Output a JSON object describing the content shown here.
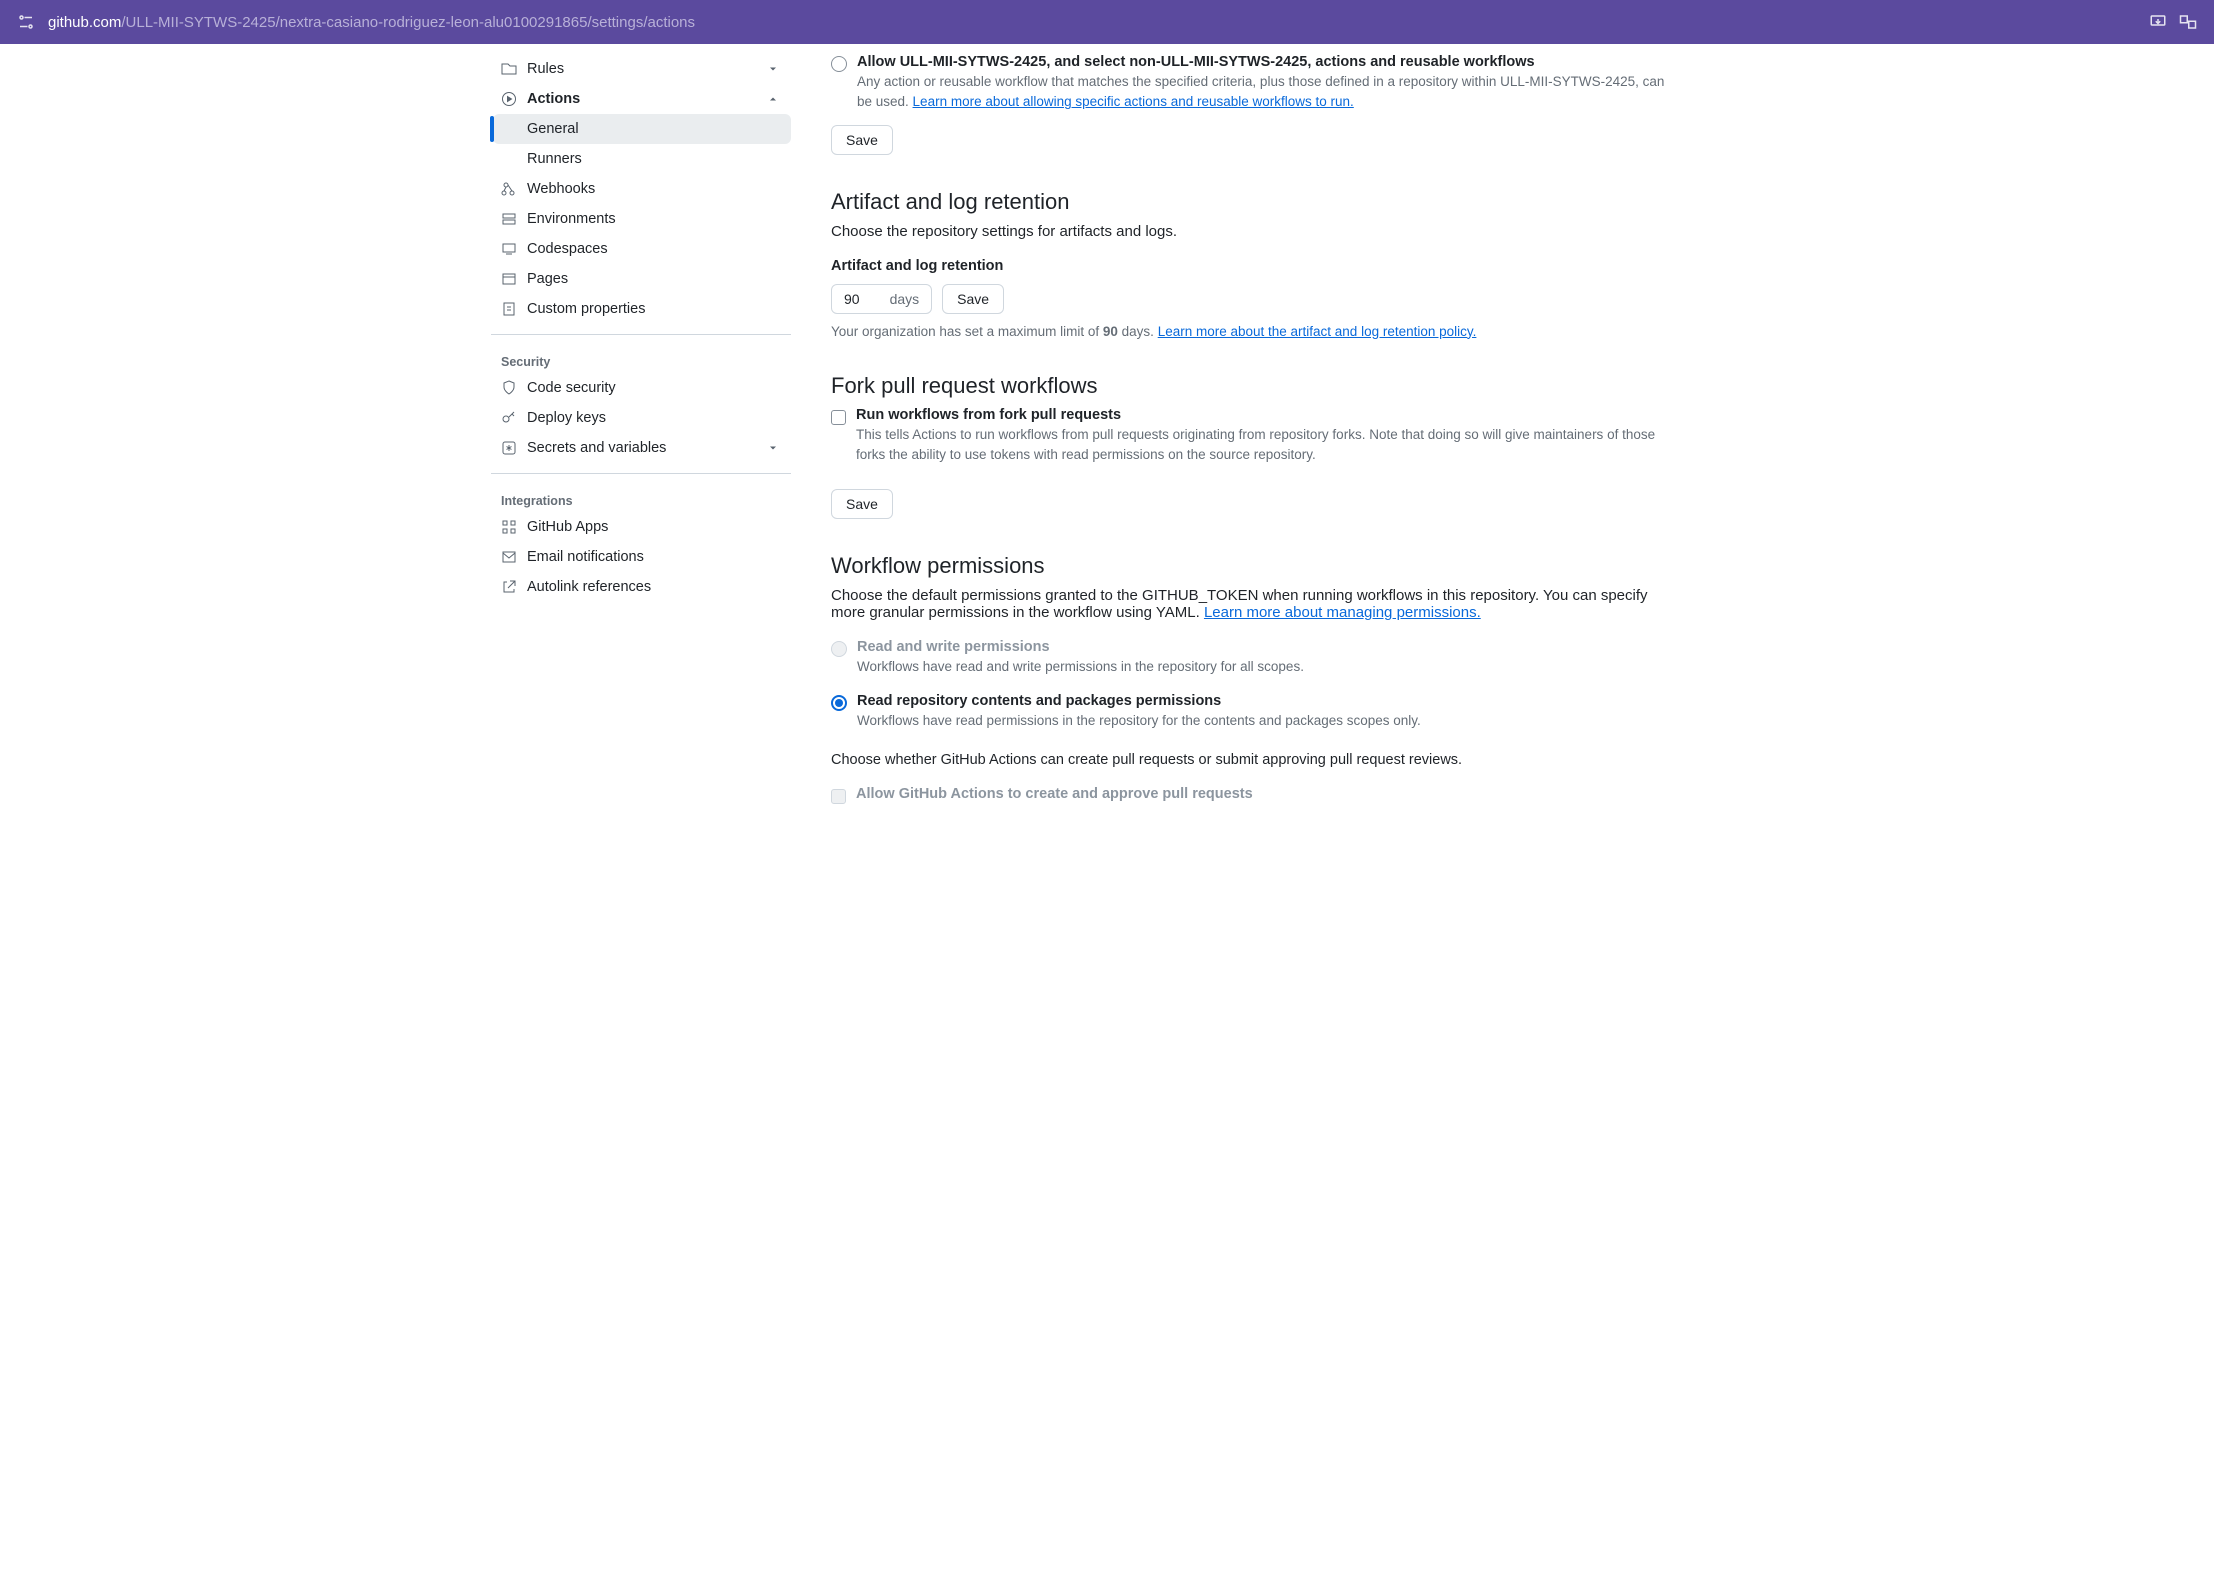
{
  "url": {
    "domain": "github.com",
    "path": "/ULL-MII-SYTWS-2425/nextra-casiano-rodriguez-leon-alu0100291865/settings/actions"
  },
  "sidebar": {
    "rules": "Rules",
    "actions": "Actions",
    "general": "General",
    "runners": "Runners",
    "webhooks": "Webhooks",
    "environments": "Environments",
    "codespaces": "Codespaces",
    "pages": "Pages",
    "custom_properties": "Custom properties",
    "security_heading": "Security",
    "code_security": "Code security",
    "deploy_keys": "Deploy keys",
    "secrets": "Secrets and variables",
    "integrations_heading": "Integrations",
    "github_apps": "GitHub Apps",
    "email_notifications": "Email notifications",
    "autolink": "Autolink references"
  },
  "actions_permissions": {
    "radio3_title": "Allow ULL-MII-SYTWS-2425, and select non-ULL-MII-SYTWS-2425, actions and reusable workflows",
    "radio3_desc": "Any action or reusable workflow that matches the specified criteria, plus those defined in a repository within ULL-MII-SYTWS-2425, can be used. ",
    "radio3_link": "Learn more about allowing specific actions and reusable workflows to run.",
    "save": "Save"
  },
  "retention": {
    "heading": "Artifact and log retention",
    "desc": "Choose the repository settings for artifacts and logs.",
    "label": "Artifact and log retention",
    "value": "90",
    "unit": "days",
    "save": "Save",
    "note_pre": "Your organization has set a maximum limit of ",
    "note_bold": "90",
    "note_post": " days. ",
    "note_link": "Learn more about the artifact and log retention policy."
  },
  "fork_pr": {
    "heading": "Fork pull request workflows",
    "check_title": "Run workflows from fork pull requests",
    "check_desc": "This tells Actions to run workflows from pull requests originating from repository forks. Note that doing so will give maintainers of those forks the ability to use tokens with read permissions on the source repository.",
    "save": "Save"
  },
  "workflow_perm": {
    "heading": "Workflow permissions",
    "desc_pre": "Choose the default permissions granted to the GITHUB_TOKEN when running workflows in this repository. You can specify more granular permissions in the workflow using YAML. ",
    "desc_link": "Learn more about managing permissions.",
    "rw_title": "Read and write permissions",
    "rw_desc": "Workflows have read and write permissions in the repository for all scopes.",
    "ro_title": "Read repository contents and packages permissions",
    "ro_desc": "Workflows have read permissions in the repository for the contents and packages scopes only.",
    "approve_desc": "Choose whether GitHub Actions can create pull requests or submit approving pull request reviews.",
    "approve_check": "Allow GitHub Actions to create and approve pull requests"
  }
}
